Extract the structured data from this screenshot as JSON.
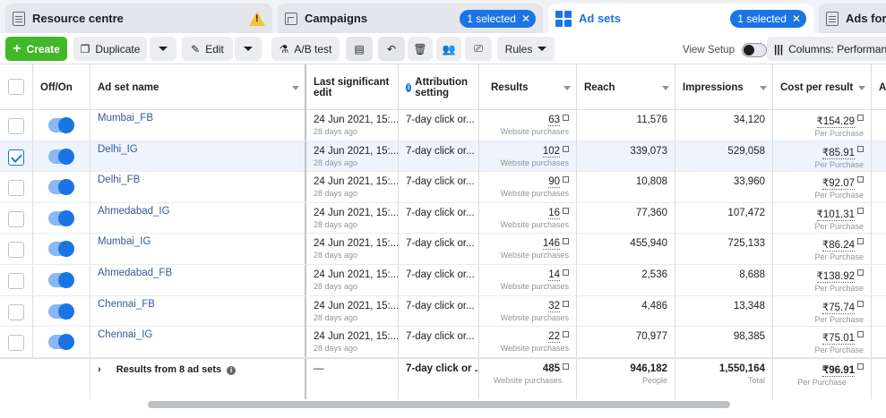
{
  "tabs": {
    "resource": "Resource centre",
    "campaigns": "Campaigns",
    "campaigns_selected": "1 selected",
    "adsets": "Ad sets",
    "adsets_selected": "1 selected",
    "ads": "Ads for 1"
  },
  "toolbar": {
    "create": "Create",
    "duplicate": "Duplicate",
    "edit": "Edit",
    "ab_test": "A/B test",
    "rules": "Rules",
    "view_setup": "View Setup",
    "columns": "Columns: Performance"
  },
  "headers": {
    "offon": "Off/On",
    "name": "Ad set name",
    "last_edit": "Last significant edit",
    "attribution": "Attribution setting",
    "results": "Results",
    "reach": "Reach",
    "impressions": "Impressions",
    "cpr": "Cost per result",
    "next": "Am"
  },
  "rows": [
    {
      "name": "Mumbai_FB",
      "edit": "24 Jun 2021, 15:...",
      "ago": "28 days ago",
      "attr": "7-day click or...",
      "results": "63",
      "results_sub": "Website purchases",
      "reach": "11,576",
      "impressions": "34,120",
      "cpr": "₹154.29",
      "cpr_sub": "Per Purchase",
      "checked": false
    },
    {
      "name": "Delhi_IG",
      "edit": "24 Jun 2021, 15:...",
      "ago": "28 days ago",
      "attr": "7-day click or...",
      "results": "102",
      "results_sub": "Website purchases",
      "reach": "339,073",
      "impressions": "529,058",
      "cpr": "₹85.91",
      "cpr_sub": "Per Purchase",
      "checked": true
    },
    {
      "name": "Delhi_FB",
      "edit": "24 Jun 2021, 15:...",
      "ago": "28 days ago",
      "attr": "7-day click or...",
      "results": "90",
      "results_sub": "Website purchases",
      "reach": "10,808",
      "impressions": "33,960",
      "cpr": "₹92.07",
      "cpr_sub": "Per Purchase",
      "checked": false
    },
    {
      "name": "Ahmedabad_IG",
      "edit": "24 Jun 2021, 15:...",
      "ago": "28 days ago",
      "attr": "7-day click or...",
      "results": "16",
      "results_sub": "Website purchases",
      "reach": "77,360",
      "impressions": "107,472",
      "cpr": "₹101.31",
      "cpr_sub": "Per Purchase",
      "checked": false
    },
    {
      "name": "Mumbai_IG",
      "edit": "24 Jun 2021, 15:...",
      "ago": "28 days ago",
      "attr": "7-day click or...",
      "results": "146",
      "results_sub": "Website purchases",
      "reach": "455,940",
      "impressions": "725,133",
      "cpr": "₹86.24",
      "cpr_sub": "Per Purchase",
      "checked": false
    },
    {
      "name": "Ahmedabad_FB",
      "edit": "24 Jun 2021, 15:...",
      "ago": "28 days ago",
      "attr": "7-day click or...",
      "results": "14",
      "results_sub": "Website purchases",
      "reach": "2,536",
      "impressions": "8,688",
      "cpr": "₹138.92",
      "cpr_sub": "Per Purchase",
      "checked": false
    },
    {
      "name": "Chennai_FB",
      "edit": "24 Jun 2021, 15:...",
      "ago": "28 days ago",
      "attr": "7-day click or...",
      "results": "32",
      "results_sub": "Website purchases",
      "reach": "4,486",
      "impressions": "13,348",
      "cpr": "₹75.74",
      "cpr_sub": "Per Purchase",
      "checked": false
    },
    {
      "name": "Chennai_IG",
      "edit": "24 Jun 2021, 15:...",
      "ago": "28 days ago",
      "attr": "7-day click or...",
      "results": "22",
      "results_sub": "Website purchases",
      "reach": "70,977",
      "impressions": "98,385",
      "cpr": "₹75.01",
      "cpr_sub": "Per Purchase",
      "checked": false
    }
  ],
  "totals": {
    "label": "Results from 8 ad sets",
    "edit": "—",
    "attr": "7-day click or ...",
    "results": "485",
    "results_sub": "Website purchases",
    "reach": "946,182",
    "reach_sub": "People",
    "impressions": "1,550,164",
    "impressions_sub": "Total",
    "cpr": "₹96.91",
    "cpr_sub": "Per Purchase"
  }
}
